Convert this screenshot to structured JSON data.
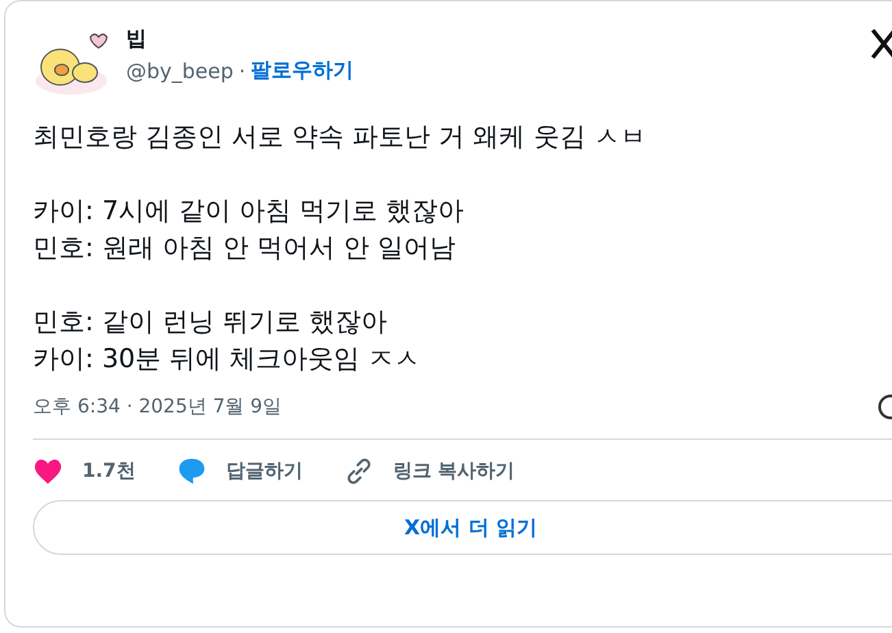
{
  "author": {
    "name": "빕",
    "handle": "@by_beep",
    "separator": "·",
    "follow": "팔로우하기"
  },
  "text": [
    [
      "최민호랑 김종인 서로 약속 파토난 거 왜케 웃김 ㅅㅂ"
    ],
    [
      "카이: 7시에 같이 아침 먹기로 했잖아",
      "민호: 원래 아침 안 먹어서 안 일어남"
    ],
    [
      "민호: 같이 런닝 뛰기로 했잖아",
      "카이: 30분 뒤에 체크아웃임 ㅈㅅ"
    ]
  ],
  "timestamp": "오후 6:34 · 2025년 7월 9일",
  "actions": [
    {
      "kind": "like",
      "label": "1.7천"
    },
    {
      "kind": "reply",
      "label": "답글하기"
    },
    {
      "kind": "copy",
      "label": "링크 복사하기"
    }
  ],
  "read_more": "X에서 더 읽기"
}
